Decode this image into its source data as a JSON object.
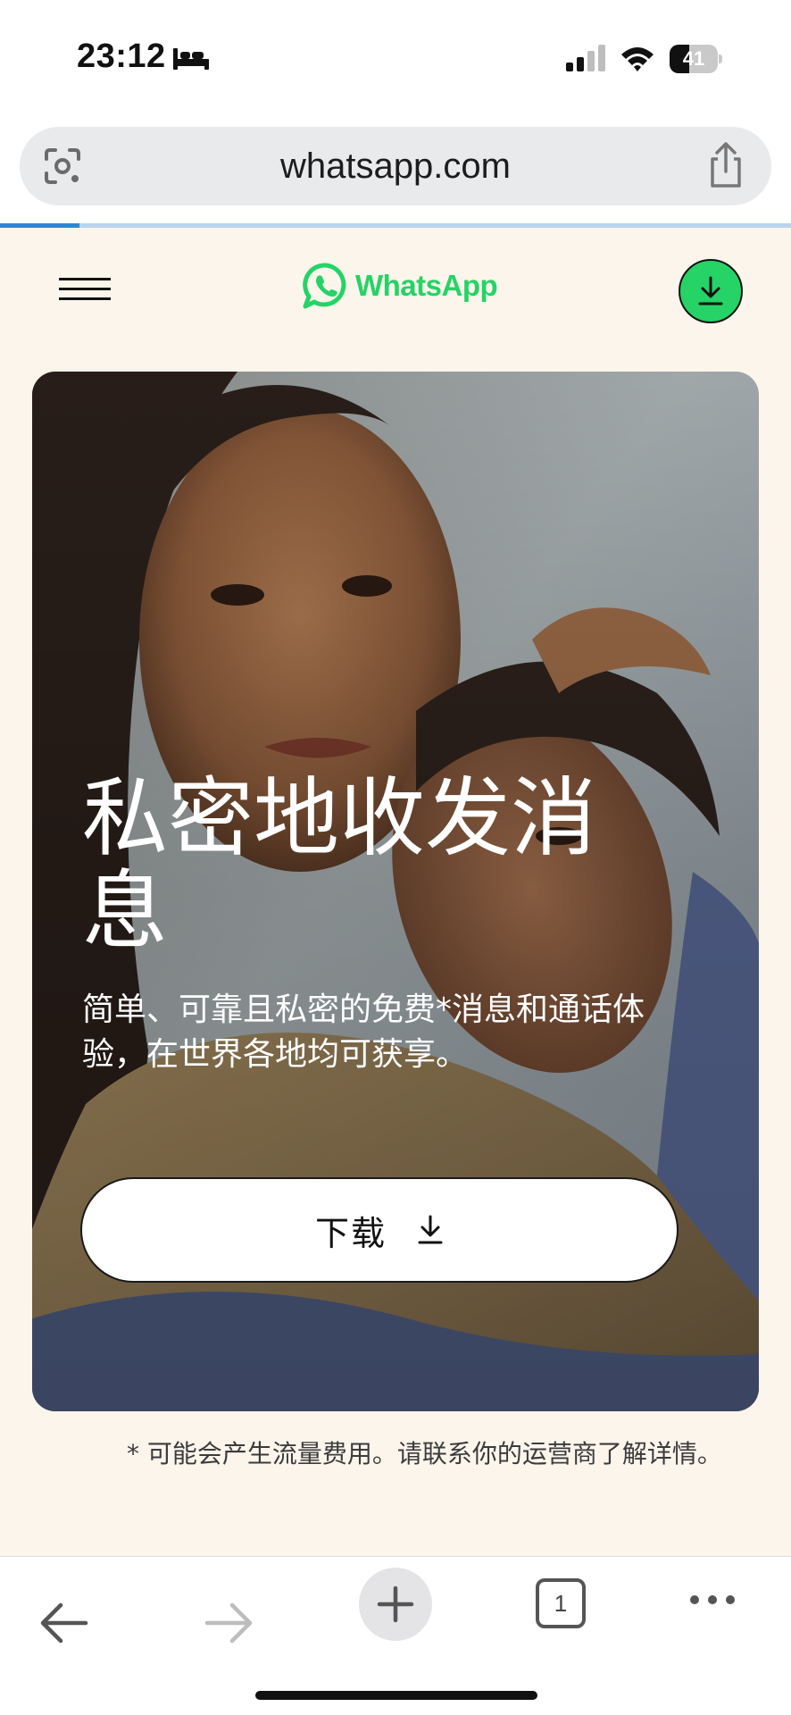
{
  "status_bar": {
    "time": "23:12",
    "battery": "41",
    "battery_level_percent": 41,
    "icons": [
      "bed-icon",
      "signal-icon",
      "wifi-icon",
      "battery-icon"
    ]
  },
  "browser": {
    "url": "whatsapp.com",
    "load_progress_fraction": 0.1,
    "icons": [
      "google-lens-icon",
      "share-icon"
    ]
  },
  "site_header": {
    "logo_text": "WhatsApp",
    "icons": [
      "menu-icon",
      "whatsapp-logo-icon",
      "download-icon"
    ]
  },
  "hero": {
    "title": "私密地收发消息",
    "subtitle": "简单、可靠且私密的免费*消息和通话体验，在世界各地均可获享。",
    "button_label": "下载"
  },
  "footnote": "* 可能会产生流量费用。请联系你的运营商了解详情。",
  "toolbar": {
    "tab_count": "1",
    "icons": [
      "back-arrow-icon",
      "forward-arrow-icon",
      "plus-icon",
      "tabs-icon",
      "more-icon"
    ]
  },
  "colors": {
    "brand_green": "#25d366",
    "page_background": "#fcf5ec",
    "progress_blue": "#2f86d6"
  }
}
